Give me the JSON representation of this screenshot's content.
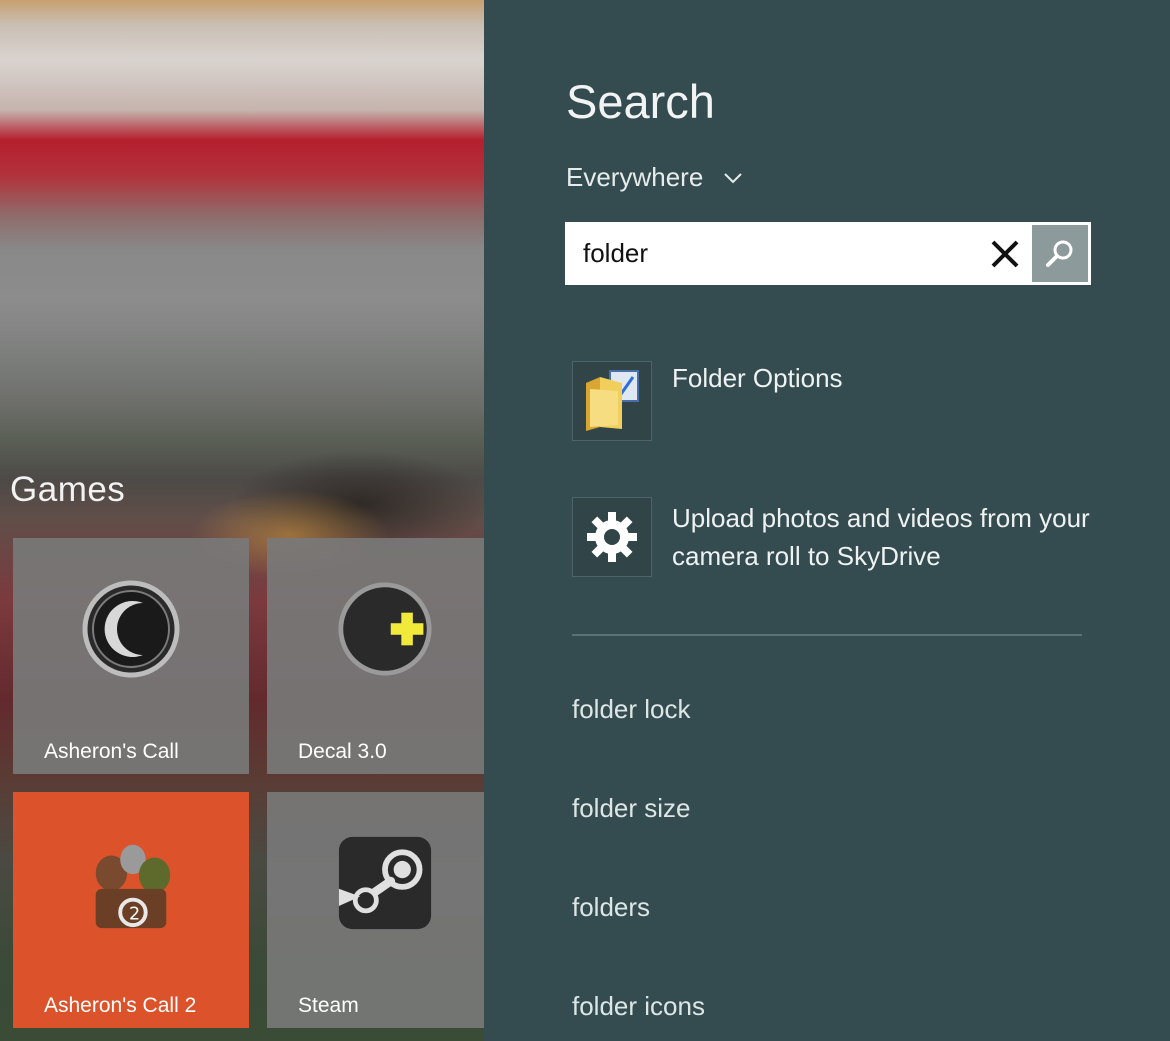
{
  "start_screen": {
    "group_title": "Games",
    "tiles": [
      {
        "label": "Asheron's Call",
        "icon": "asherons-call-icon"
      },
      {
        "label": "Decal 3.0",
        "icon": "decal-icon"
      },
      {
        "label": "Asheron's Call 2",
        "icon": "asherons-call-2-icon",
        "color": "#dc532b"
      },
      {
        "label": "Steam",
        "icon": "steam-icon"
      }
    ]
  },
  "search": {
    "title": "Search",
    "scope": "Everywhere",
    "query": "folder",
    "results": [
      {
        "label": "Folder Options",
        "icon": "folder-options-icon"
      },
      {
        "label": "Upload photos and videos from your camera roll to SkyDrive",
        "icon": "gear-icon"
      }
    ],
    "suggestions": [
      "folder lock",
      "folder size",
      "folders",
      "folder icons"
    ]
  },
  "colors": {
    "charm_background": "#344b4f",
    "tile_orange": "#dc532b",
    "search_button": "#8d9a9b"
  }
}
